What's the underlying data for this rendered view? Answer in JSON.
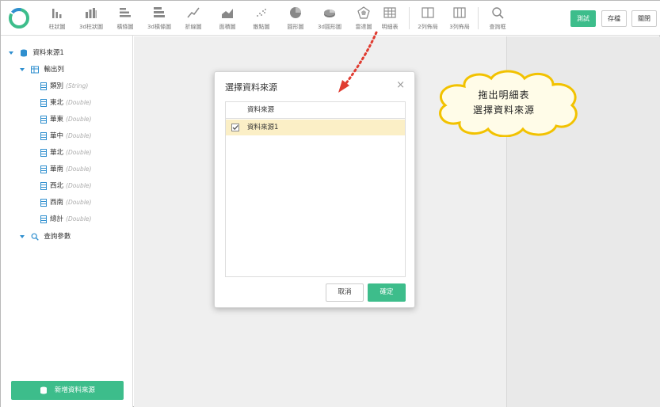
{
  "toolbar": {
    "tools": [
      {
        "label": "柱狀圖",
        "icon": "bar-chart-icon"
      },
      {
        "label": "3d柱狀圖",
        "icon": "bar-3d-chart-icon"
      },
      {
        "label": "橫條圖",
        "icon": "horizontal-bar-icon"
      },
      {
        "label": "3d橫條圖",
        "icon": "horizontal-bar-3d-icon"
      },
      {
        "label": "折線圖",
        "icon": "line-chart-icon"
      },
      {
        "label": "面積圖",
        "icon": "area-chart-icon"
      },
      {
        "label": "散點圖",
        "icon": "scatter-chart-icon"
      },
      {
        "label": "圓形圖",
        "icon": "pie-chart-icon"
      },
      {
        "label": "3d圓形圖",
        "icon": "pie-3d-chart-icon"
      },
      {
        "label": "雷達圖",
        "icon": "radar-chart-icon"
      },
      {
        "label": "明細表",
        "icon": "detail-table-icon"
      },
      {
        "label": "2列佈局",
        "icon": "two-column-layout-icon"
      },
      {
        "label": "3列佈局",
        "icon": "three-column-layout-icon"
      },
      {
        "label": "查詢框",
        "icon": "search-icon"
      }
    ],
    "test_label": "測試",
    "save_label": "存檔",
    "close_label": "關閉"
  },
  "sidebar": {
    "datasource": "資料來源1",
    "output_label": "輸出列",
    "fields": [
      {
        "name": "類別",
        "type": "(String)"
      },
      {
        "name": "東北",
        "type": "(Double)"
      },
      {
        "name": "華東",
        "type": "(Double)"
      },
      {
        "name": "華中",
        "type": "(Double)"
      },
      {
        "name": "華北",
        "type": "(Double)"
      },
      {
        "name": "華南",
        "type": "(Double)"
      },
      {
        "name": "西北",
        "type": "(Double)"
      },
      {
        "name": "西南",
        "type": "(Double)"
      },
      {
        "name": "總計",
        "type": "(Double)"
      }
    ],
    "query_params": "查詢參數",
    "add_button": "新增資料來源"
  },
  "dialog": {
    "title": "選擇資料來源",
    "column_header": "資料來源",
    "rows": [
      {
        "name": "資料來源1",
        "checked": true
      }
    ],
    "cancel_label": "取消",
    "ok_label": "確定"
  },
  "callout": {
    "line1": "拖出明細表",
    "line2": "選擇資料來源"
  },
  "colors": {
    "accent": "#3dbd8b",
    "tree_icon": "#2f8fcf",
    "selected_row": "#fbefc6",
    "arrow": "#e03c31",
    "callout_border": "#f2c200",
    "callout_fill": "#fffce8"
  }
}
